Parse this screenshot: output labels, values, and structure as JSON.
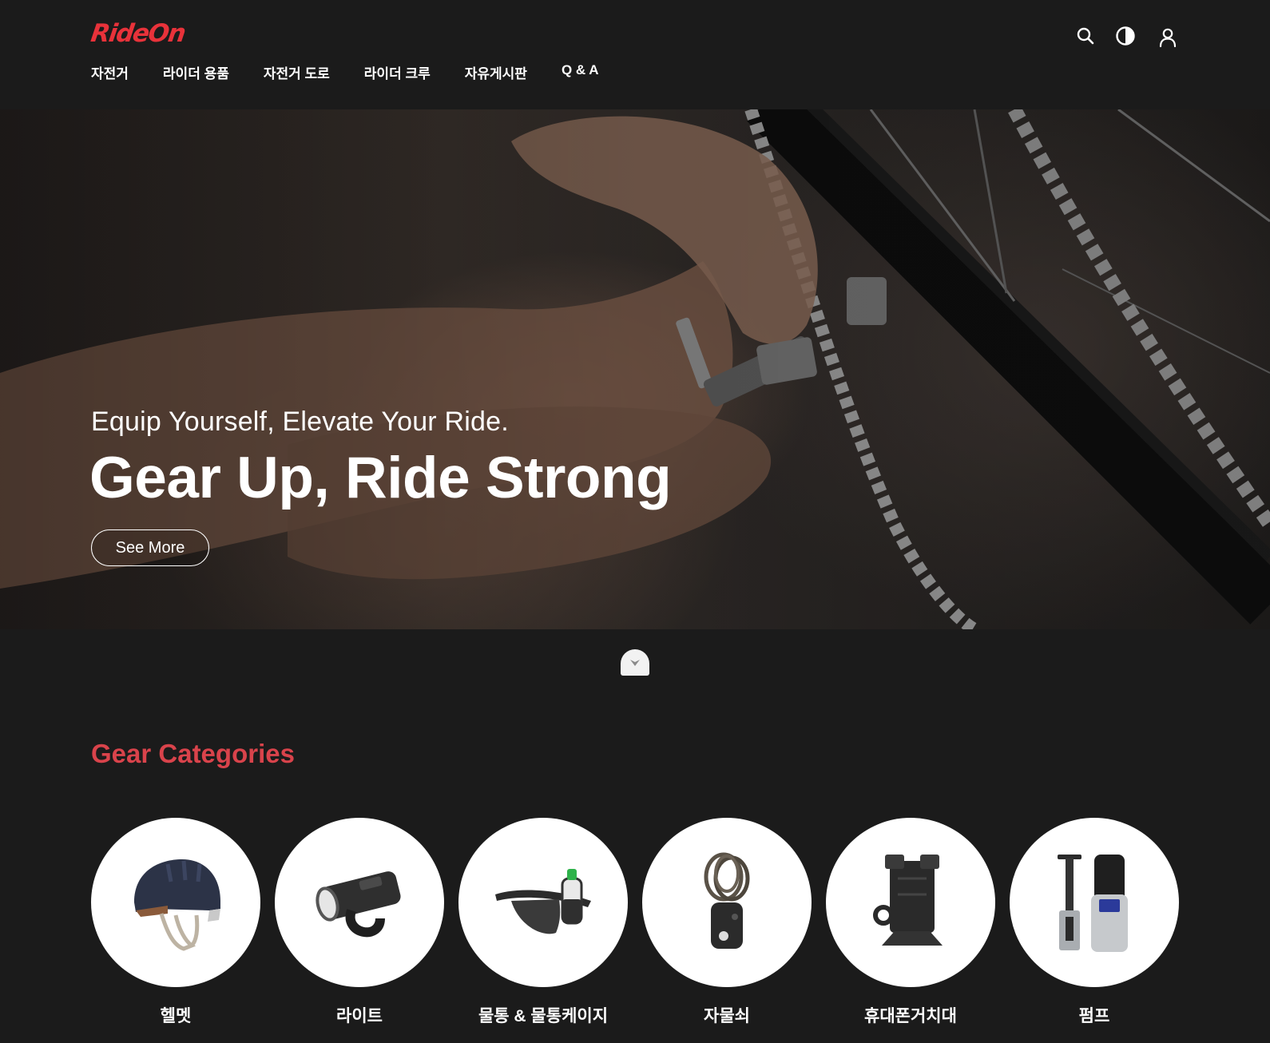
{
  "brand": {
    "logo": "RideOn",
    "logo_color": "#e8323a"
  },
  "nav": {
    "items": [
      {
        "label": "자전거"
      },
      {
        "label": "라이더 용품"
      },
      {
        "label": "자전거 도로"
      },
      {
        "label": "라이더 크루"
      },
      {
        "label": "자유게시판"
      },
      {
        "label": "Q & A"
      }
    ]
  },
  "header_icons": {
    "search": "search-icon",
    "theme": "contrast-icon",
    "account": "user-icon"
  },
  "hero": {
    "subtitle": "Equip Yourself, Elevate Your Ride.",
    "title": "Gear Up, Ride Strong",
    "button_label": "See More"
  },
  "scroll_down": {
    "icon": "chevron-down-icon"
  },
  "categories": {
    "title": "Gear Categories",
    "title_color": "#d9434b",
    "items": [
      {
        "label": "헬멧",
        "icon": "helmet-icon"
      },
      {
        "label": "라이트",
        "icon": "bike-light-icon"
      },
      {
        "label": "물통 & 물통케이지",
        "icon": "bottle-belt-icon"
      },
      {
        "label": "자물쇠",
        "icon": "cable-lock-icon"
      },
      {
        "label": "휴대폰거치대",
        "icon": "phone-mount-icon"
      },
      {
        "label": "펌프",
        "icon": "pump-icon"
      }
    ]
  }
}
